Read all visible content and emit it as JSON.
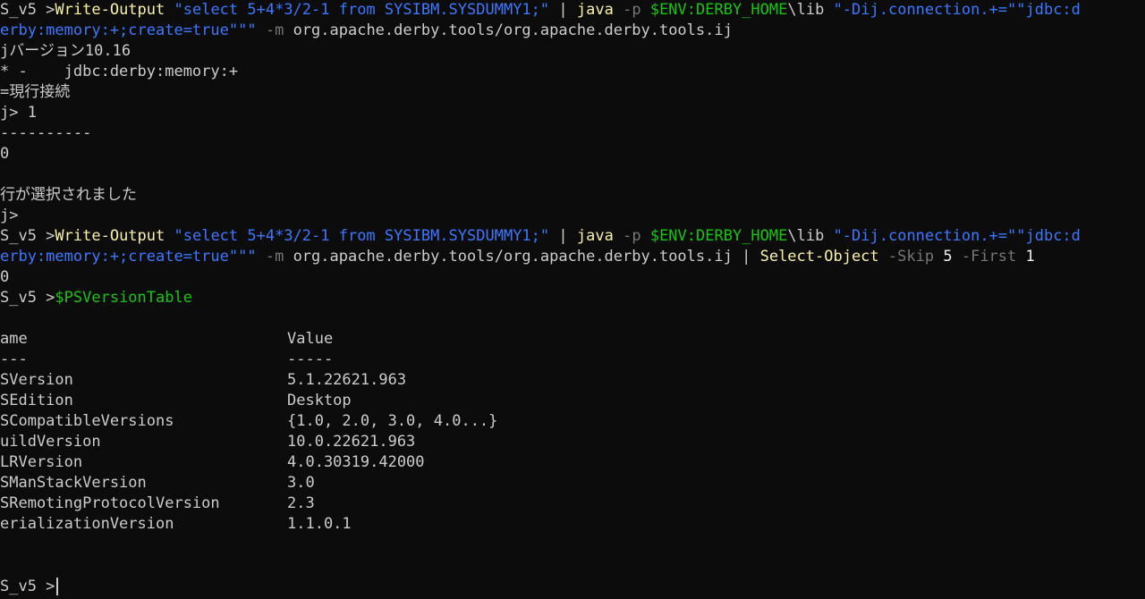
{
  "colors": {
    "background": "#0c0c0c",
    "foreground": "#cccccc",
    "command": "#f9f1a5",
    "string": "#3b78ff",
    "parameter": "#767676",
    "variable": "#16c60c",
    "number": "#f2f2f2"
  },
  "session1": {
    "prompt": "S_v5 >",
    "cmd_write": "Write-Output",
    "arg_query": "\"select 5+4*3/2-1 from SYSIBM.SYSDUMMY1;\"",
    "pipe": "|",
    "cmd_java": "java",
    "param_p": "-p",
    "var_env": "$ENV:DERBY_HOME",
    "lib_path": "\\lib",
    "arg_conn_a": "\"-Dij.connection.+=\"\"jdbc:d",
    "arg_conn_b": "erby:memory:+;create=true\"\"\"",
    "param_m": "-m",
    "module": "org.apache.derby.tools/org.apache.derby.tools.ij"
  },
  "output1": {
    "version_line": "jバージョン10.16",
    "conn_line": "* -    jdbc:derby:memory:+",
    "current_conn": "=現行接続",
    "ij_result": "j> 1",
    "separator": "----------",
    "value": "0",
    "rows_selected": "行が選択されました",
    "ij_prompt": "j>"
  },
  "session2": {
    "prompt": "S_v5 >",
    "cmd_write": "Write-Output",
    "arg_query": "\"select 5+4*3/2-1 from SYSIBM.SYSDUMMY1;\"",
    "pipe": "|",
    "cmd_java": "java",
    "param_p": "-p",
    "var_env": "$ENV:DERBY_HOME",
    "lib_path": "\\lib",
    "arg_conn_a": "\"-Dij.connection.+=\"\"jdbc:d",
    "arg_conn_b": "erby:memory:+;create=true\"\"\"",
    "param_m": "-m",
    "module": "org.apache.derby.tools/org.apache.derby.tools.ij",
    "pipe2": "|",
    "cmd_select": "Select-Object",
    "param_skip": "-Skip",
    "skip_value": "5",
    "param_first": "-First",
    "first_value": "1",
    "result": "0"
  },
  "session3": {
    "prompt": "S_v5 >",
    "variable": "$PSVersionTable"
  },
  "table": {
    "header_name": "ame",
    "header_value": "Value",
    "sep_name": "---",
    "sep_value": "-----",
    "rows": [
      {
        "name": "SVersion",
        "value": "5.1.22621.963"
      },
      {
        "name": "SEdition",
        "value": "Desktop"
      },
      {
        "name": "SCompatibleVersions",
        "value": "{1.0, 2.0, 3.0, 4.0...}"
      },
      {
        "name": "uildVersion",
        "value": "10.0.22621.963"
      },
      {
        "name": "LRVersion",
        "value": "4.0.30319.42000"
      },
      {
        "name": "SManStackVersion",
        "value": "3.0"
      },
      {
        "name": "SRemotingProtocolVersion",
        "value": "2.3"
      },
      {
        "name": "erializationVersion",
        "value": "1.1.0.1"
      }
    ]
  },
  "final_prompt": "S_v5 >"
}
